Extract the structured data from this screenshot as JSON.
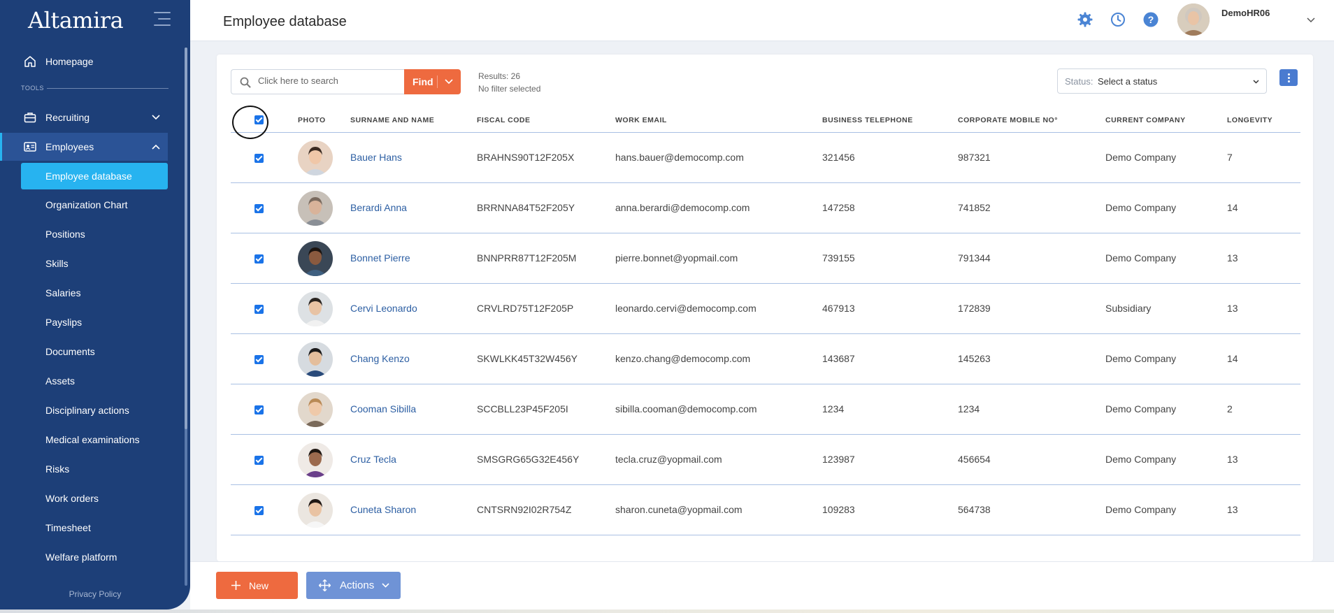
{
  "app": {
    "logo": "Altamira"
  },
  "sidebar": {
    "tools_label": "TOOLS",
    "homepage": "Homepage",
    "recruiting": "Recruiting",
    "employees": "Employees",
    "sub_items": [
      {
        "label": "Employee database",
        "active": true
      },
      {
        "label": "Organization Chart"
      },
      {
        "label": "Positions"
      },
      {
        "label": "Skills"
      },
      {
        "label": "Salaries"
      },
      {
        "label": "Payslips"
      },
      {
        "label": "Documents"
      },
      {
        "label": "Assets"
      },
      {
        "label": "Disciplinary actions"
      },
      {
        "label": "Medical examinations"
      },
      {
        "label": "Risks"
      },
      {
        "label": "Work orders"
      },
      {
        "label": "Timesheet"
      },
      {
        "label": "Welfare platform"
      }
    ],
    "privacy": "Privacy Policy"
  },
  "header": {
    "title": "Employee database",
    "icons": [
      "gear-icon",
      "clock-icon",
      "help-icon"
    ],
    "user_name": "DemoHR06"
  },
  "toolbar": {
    "search_placeholder": "Click here to search",
    "find_label": "Find",
    "results": "Results: 26",
    "filter": "No filter selected",
    "status_prefix": "Status:",
    "status_value": "Select a status"
  },
  "table": {
    "columns": [
      "PHOTO",
      "SURNAME AND NAME",
      "FISCAL CODE",
      "WORK EMAIL",
      "BUSINESS TELEPHONE",
      "CORPORATE MOBILE NO°",
      "CURRENT COMPANY",
      "LONGEVITY"
    ],
    "rows": [
      {
        "name": "Bauer Hans",
        "fiscal": "BRAHNS90T12F205X",
        "email": "hans.bauer@democomp.com",
        "tel": "321456",
        "mobile": "987321",
        "company": "Demo Company",
        "longevity": "7"
      },
      {
        "name": "Berardi Anna",
        "fiscal": "BRRNNA84T52F205Y",
        "email": "anna.berardi@democomp.com",
        "tel": "147258",
        "mobile": "741852",
        "company": "Demo Company",
        "longevity": "14"
      },
      {
        "name": "Bonnet Pierre",
        "fiscal": "BNNPRR87T12F205M",
        "email": "pierre.bonnet@yopmail.com",
        "tel": "739155",
        "mobile": "791344",
        "company": "Demo Company",
        "longevity": "13"
      },
      {
        "name": "Cervi Leonardo",
        "fiscal": "CRVLRD75T12F205P",
        "email": "leonardo.cervi@democomp.com",
        "tel": "467913",
        "mobile": "172839",
        "company": "Subsidiary",
        "longevity": "13"
      },
      {
        "name": "Chang Kenzo",
        "fiscal": "SKWLKK45T32W456Y",
        "email": "kenzo.chang@democomp.com",
        "tel": "143687",
        "mobile": "145263",
        "company": "Demo Company",
        "longevity": "14"
      },
      {
        "name": "Cooman Sibilla",
        "fiscal": "SCCBLL23P45F205I",
        "email": "sibilla.cooman@democomp.com",
        "tel": "1234",
        "mobile": "1234",
        "company": "Demo Company",
        "longevity": "2"
      },
      {
        "name": "Cruz Tecla",
        "fiscal": "SMSGRG65G32E456Y",
        "email": "tecla.cruz@yopmail.com",
        "tel": "123987",
        "mobile": "456654",
        "company": "Demo Company",
        "longevity": "13"
      },
      {
        "name": "Cuneta Sharon",
        "fiscal": "CNTSRN92I02R754Z",
        "email": "sharon.cuneta@yopmail.com",
        "tel": "109283",
        "mobile": "564738",
        "company": "Demo Company",
        "longevity": "13"
      }
    ]
  },
  "bottom": {
    "new_label": "New",
    "actions_label": "Actions"
  },
  "colors": {
    "sidebar": "#1d3f78",
    "accent_blue": "#27b3f0",
    "orange": "#ee6a3f",
    "link": "#2d5fa3",
    "actions": "#6f93d6"
  }
}
